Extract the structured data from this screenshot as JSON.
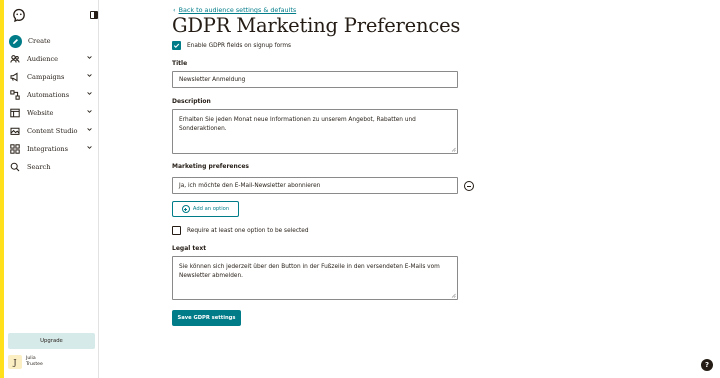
{
  "sidebar": {
    "items": [
      {
        "label": "Create",
        "icon": "pencil-icon"
      },
      {
        "label": "Audience",
        "icon": "audience-icon"
      },
      {
        "label": "Campaigns",
        "icon": "megaphone-icon"
      },
      {
        "label": "Automations",
        "icon": "automations-icon"
      },
      {
        "label": "Website",
        "icon": "website-icon"
      },
      {
        "label": "Content Studio",
        "icon": "content-studio-icon"
      },
      {
        "label": "Integrations",
        "icon": "grid-icon"
      },
      {
        "label": "Search",
        "icon": "search-icon"
      }
    ],
    "upgrade_label": "Upgrade",
    "user": {
      "initial": "J",
      "name": "Julia",
      "org": "Trustee"
    }
  },
  "main": {
    "back_link": "Back to audience settings & defaults",
    "title": "GDPR Marketing Preferences",
    "enable_gdpr_label": "Enable GDPR fields on signup forms",
    "enable_gdpr_checked": true,
    "title_label": "Title",
    "title_value": "Newsletter Anmeldung",
    "description_label": "Description",
    "description_value": "Erhalten Sie jeden Monat neue Informationen zu unserem Angebot, Rabatten und Sonderaktionen.",
    "marketing_label": "Marketing preferences",
    "marketing_option_value": "Ja, ich möchte den E-Mail-Newsletter abonnieren",
    "add_option_label": "Add an option",
    "require_label": "Require at least one option to be selected",
    "require_checked": false,
    "legal_label": "Legal text",
    "legal_value": "Sie können sich jederzeit über den Button in der Fußzeile in den versendeten E-Mails vom Newsletter abmelden.",
    "save_label": "Save GDPR settings"
  },
  "help_label": "?",
  "colors": {
    "accent": "#007c89",
    "brand_yellow": "#ffe01b",
    "text": "#241c15"
  }
}
